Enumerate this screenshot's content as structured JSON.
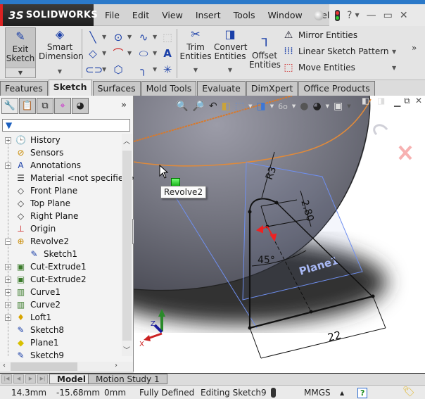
{
  "app": {
    "brand": "SOLIDWORKS",
    "brand_prefix": "3S",
    "menu": [
      "File",
      "Edit",
      "View",
      "Insert",
      "Tools",
      "Window",
      "Help"
    ],
    "window_controls": {
      "help": "?",
      "minimize": "—",
      "restore": "▭",
      "close": "✕"
    }
  },
  "commandmanager": {
    "exit_sketch": "Exit Sketch",
    "smart_dimension": "Smart Dimension",
    "trim_entities": "Trim Entities",
    "convert_entities": "Convert Entities",
    "offset_entities": "Offset Entities",
    "mirror_entities": "Mirror Entities",
    "linear_sketch_pattern": "Linear Sketch Pattern",
    "move_entities": "Move Entities",
    "sketch_tools": [
      "line-icon",
      "circle-icon",
      "spline-icon",
      "construction-geometry-icon",
      "rectangle-icon",
      "arc-icon",
      "ellipse-icon",
      "text-icon",
      "slot-icon",
      "polygon-icon",
      "fillet-icon",
      "point-icon"
    ]
  },
  "tabs": [
    {
      "label": "Features",
      "active": false
    },
    {
      "label": "Sketch",
      "active": true
    },
    {
      "label": "Surfaces",
      "active": false
    },
    {
      "label": "Mold Tools",
      "active": false
    },
    {
      "label": "Evaluate",
      "active": false
    },
    {
      "label": "DimXpert",
      "active": false
    },
    {
      "label": "Office Products",
      "active": false
    }
  ],
  "feature_tree": {
    "panel_tabs": [
      "featuremanager-icon",
      "propertymanager-icon",
      "configurationmanager-icon",
      "dimxpertmanager-icon",
      "displaymanager-icon"
    ],
    "more": "»",
    "items": [
      {
        "label": "History",
        "icon": "history-folder-icon",
        "expandable": true,
        "expanded": false,
        "child": false
      },
      {
        "label": "Sensors",
        "icon": "sensors-folder-icon",
        "expandable": false,
        "child": false
      },
      {
        "label": "Annotations",
        "icon": "annotations-folder-icon",
        "expandable": true,
        "expanded": false,
        "child": false
      },
      {
        "label": "Material <not specified>",
        "icon": "material-icon",
        "expandable": false,
        "child": false
      },
      {
        "label": "Front Plane",
        "icon": "plane-icon",
        "expandable": false,
        "child": false
      },
      {
        "label": "Top Plane",
        "icon": "plane-icon",
        "expandable": false,
        "child": false
      },
      {
        "label": "Right Plane",
        "icon": "plane-icon",
        "expandable": false,
        "child": false
      },
      {
        "label": "Origin",
        "icon": "origin-icon",
        "expandable": false,
        "child": false
      },
      {
        "label": "Revolve2",
        "icon": "revolve-icon",
        "expandable": true,
        "expanded": true,
        "child": false
      },
      {
        "label": "Sketch1",
        "icon": "sketch-icon",
        "expandable": false,
        "child": true
      },
      {
        "label": "Cut-Extrude1",
        "icon": "cut-extrude-icon",
        "expandable": true,
        "expanded": false,
        "child": false
      },
      {
        "label": "Cut-Extrude2",
        "icon": "cut-extrude-icon",
        "expandable": true,
        "expanded": false,
        "child": false
      },
      {
        "label": "Curve1",
        "icon": "curve-icon",
        "expandable": true,
        "expanded": false,
        "child": false
      },
      {
        "label": "Curve2",
        "icon": "curve-icon",
        "expandable": true,
        "expanded": false,
        "child": false
      },
      {
        "label": "Loft1",
        "icon": "loft-icon",
        "expandable": true,
        "expanded": false,
        "child": false
      },
      {
        "label": "Sketch8",
        "icon": "sketch-icon",
        "expandable": false,
        "child": false
      },
      {
        "label": "Plane1",
        "icon": "plane-feature-icon",
        "expandable": false,
        "child": false
      },
      {
        "label": "Sketch9",
        "icon": "sketch-editing-icon",
        "expandable": false,
        "child": false
      }
    ]
  },
  "viewport": {
    "tooltip": "Revolve2",
    "dimensions": {
      "radius": "R3",
      "height": "2.80",
      "angle": "45°",
      "width": "22"
    },
    "plane_label": "Plane1",
    "triad": {
      "x": "X",
      "z": "Z"
    }
  },
  "bottom_tabs": [
    {
      "label": "Model",
      "active": true
    },
    {
      "label": "Motion Study 1",
      "active": false
    }
  ],
  "status_bar": {
    "x": "14.3mm",
    "y": "-15.68mm",
    "z": "0mm",
    "definition": "Fully Defined",
    "mode": "Editing Sketch9",
    "units": "MMGS",
    "units_arrow": "▲",
    "help": "?"
  },
  "colors": {
    "accent_blue": "#1a3fa8",
    "title_bar": "#2b79c9",
    "sketch_orange": "#e08a3a",
    "plane_blue": "#6f8ff0"
  }
}
